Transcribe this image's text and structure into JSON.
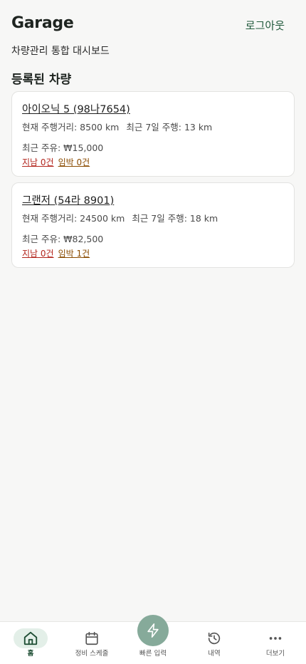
{
  "header": {
    "title": "Garage",
    "logout_label": "로그아웃"
  },
  "subtitle": "차량관리 통합 대시보드",
  "section_title": "등록된 차량",
  "vehicles": [
    {
      "name": "아이오닉 5 (98나7654)",
      "odometer": "현재 주행거리: 8500 km",
      "recent_7d": "최근 7일 주행: 13 km",
      "recent_fuel": "최근 주유: ₩15,000",
      "overdue": "지남 0건",
      "upcoming": "임박 0건"
    },
    {
      "name": "그랜저 (54라 8901)",
      "odometer": "현재 주행거리: 24500 km",
      "recent_7d": "최근 7일 주행: 18 km",
      "recent_fuel": "최근 주유: ₩82,500",
      "overdue": "지남 0건",
      "upcoming": "임박 1건"
    }
  ],
  "nav": {
    "home": {
      "label": "홈",
      "icon": "home-icon"
    },
    "schedule": {
      "label": "정비 스케줄",
      "icon": "calendar-icon"
    },
    "quick_input": {
      "label": "빠른 입력",
      "icon": "lightning-icon"
    },
    "history": {
      "label": "내역",
      "icon": "history-icon"
    },
    "more": {
      "label": "더보기",
      "icon": "more-icon"
    }
  },
  "colors": {
    "accent": "#215a3c",
    "active_pill": "#e3efe8",
    "fab": "#86aa9a",
    "overdue": "#b3261e",
    "upcoming": "#8a4b00"
  }
}
